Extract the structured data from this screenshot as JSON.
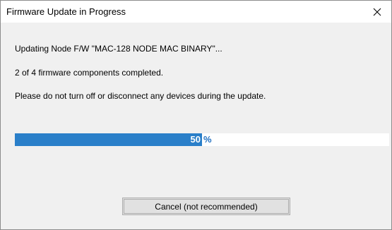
{
  "window": {
    "title": "Firmware Update in Progress"
  },
  "messages": {
    "updating": "Updating Node F/W \"MAC-128 NODE MAC BINARY\"...",
    "components": "2 of 4 firmware components completed.",
    "warning": "Please do not turn off or disconnect any devices during the update."
  },
  "progress": {
    "value": "50",
    "unit": "%",
    "fraction": 0.5
  },
  "buttons": {
    "cancel_label": "Cancel (not recommended)"
  },
  "icons": {
    "close": "close-icon"
  },
  "colors": {
    "progress_fill": "#2a7fc9",
    "background": "#f0f0f0"
  }
}
